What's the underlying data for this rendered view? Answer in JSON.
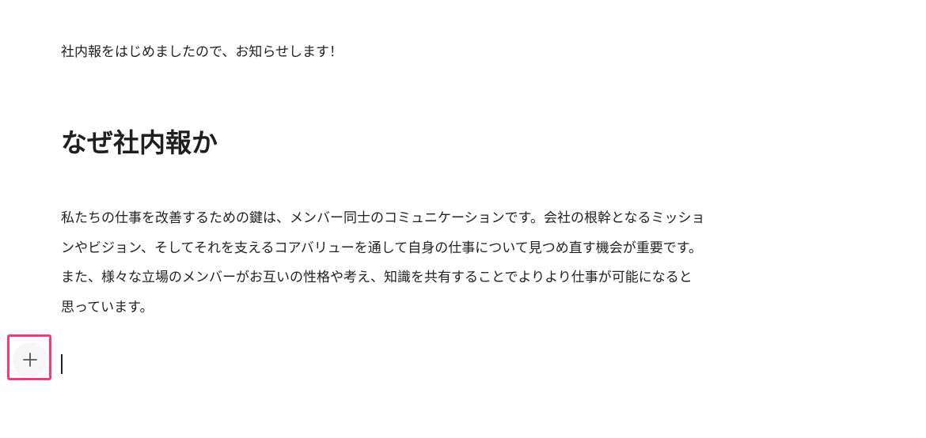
{
  "editor": {
    "intro_paragraph": "社内報をはじめましたので、お知らせします！",
    "heading": "なぜ社内報か",
    "body_lines": [
      "私たちの仕事を改善するための鍵は、メンバー同士のコミュニケーションです。会社の根幹となるミッショ",
      "ンやビジョン、そしてそれを支えるコアバリューを通して自身の仕事について見つめ直す機会が重要です。",
      "また、様々な立場のメンバーがお互いの性格や考え、知識を共有することでよりより仕事が可能になると",
      "思っています。"
    ]
  },
  "add_block": {
    "icon": "plus-icon",
    "highlight_color": "#f03c7a"
  }
}
